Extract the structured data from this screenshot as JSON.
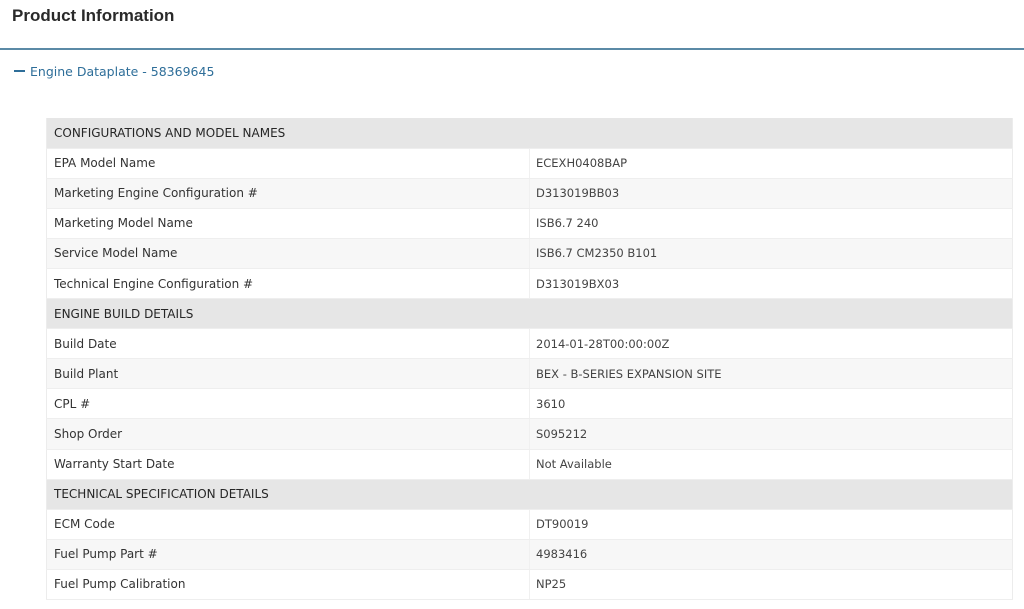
{
  "page": {
    "title": "Product Information"
  },
  "accordion": {
    "label": "Engine Dataplate - 58369645"
  },
  "sections": [
    {
      "heading": "CONFIGURATIONS AND MODEL NAMES",
      "rows": [
        {
          "label": "EPA Model Name",
          "value": "ECEXH0408BAP"
        },
        {
          "label": "Marketing Engine Configuration #",
          "value": "D313019BB03"
        },
        {
          "label": "Marketing Model Name",
          "value": "ISB6.7 240"
        },
        {
          "label": "Service Model Name",
          "value": "ISB6.7 CM2350 B101"
        },
        {
          "label": "Technical Engine Configuration #",
          "value": "D313019BX03"
        }
      ]
    },
    {
      "heading": "ENGINE BUILD DETAILS",
      "rows": [
        {
          "label": "Build Date",
          "value": "2014-01-28T00:00:00Z"
        },
        {
          "label": "Build Plant",
          "value": "BEX - B-SERIES EXPANSION SITE"
        },
        {
          "label": "CPL #",
          "value": "3610"
        },
        {
          "label": "Shop Order",
          "value": "S095212"
        },
        {
          "label": "Warranty Start Date",
          "value": "Not Available"
        }
      ]
    },
    {
      "heading": "TECHNICAL SPECIFICATION DETAILS",
      "rows": [
        {
          "label": "ECM Code",
          "value": "DT90019"
        },
        {
          "label": "Fuel Pump Part #",
          "value": "4983416"
        },
        {
          "label": "Fuel Pump Calibration",
          "value": "NP25"
        }
      ]
    }
  ]
}
